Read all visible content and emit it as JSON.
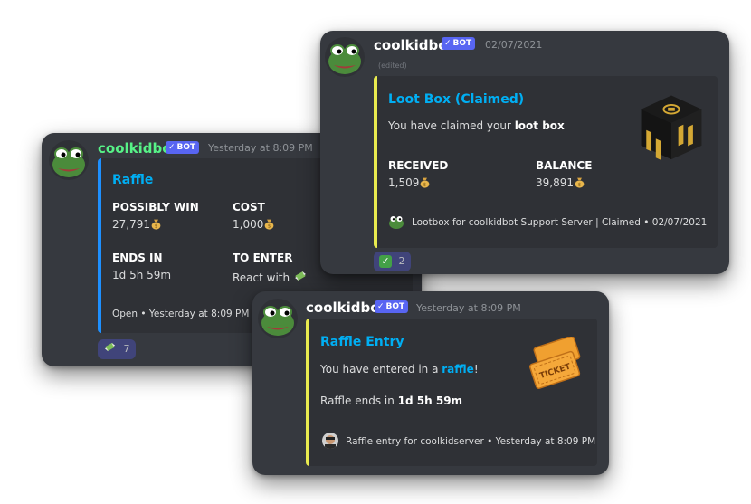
{
  "raffle_card": {
    "username": "coolkidbot",
    "bot_label": "BOT",
    "timestamp": "Yesterday at 8:09 PM",
    "title": "Raffle",
    "fields": [
      {
        "name": "POSSIBLY WIN",
        "value": "27,791"
      },
      {
        "name": "COST",
        "value": "1,000"
      },
      {
        "name": "ENDS IN",
        "value": "1d 5h 59m"
      },
      {
        "name": "TO ENTER",
        "value": "React with"
      }
    ],
    "footer": "Open • Yesterday at 8:09 PM",
    "reaction_count": "7",
    "accent": "#1e90ff",
    "username_color": "#57f287"
  },
  "loot_card": {
    "username": "coolkidbot",
    "bot_label": "BOT",
    "timestamp": "02/07/2021",
    "edited": "(edited)",
    "title": "Loot Box (Claimed)",
    "desc_prefix": "You have claimed your ",
    "desc_bold": "loot box",
    "fields": [
      {
        "name": "RECEIVED",
        "value": "1,509"
      },
      {
        "name": "BALANCE",
        "value": "39,891"
      }
    ],
    "footer": "Lootbox for coolkidbot Support Server | Claimed • 02/07/2021",
    "reaction_count": "2",
    "accent": "#e9eb4f"
  },
  "entry_card": {
    "username": "coolkidbot",
    "bot_label": "BOT",
    "timestamp": "Yesterday at 8:09 PM",
    "title": "Raffle Entry",
    "desc_prefix": "You have entered in a ",
    "desc_link": "raffle",
    "desc_suffix": "!",
    "ends_prefix": "Raffle ends in ",
    "ends_bold": "1d 5h 59m",
    "footer": "Raffle entry for coolkidserver • Yesterday at 8:09 PM",
    "accent": "#e9eb4f"
  },
  "icons": {
    "avatar": "pepe-frog-avatar",
    "money_bag": "money-bag-icon",
    "money_wings": "money-with-wings-icon",
    "check": "check-mark-icon",
    "loot_box": "loot-box-image",
    "ticket": "ticket-image"
  }
}
